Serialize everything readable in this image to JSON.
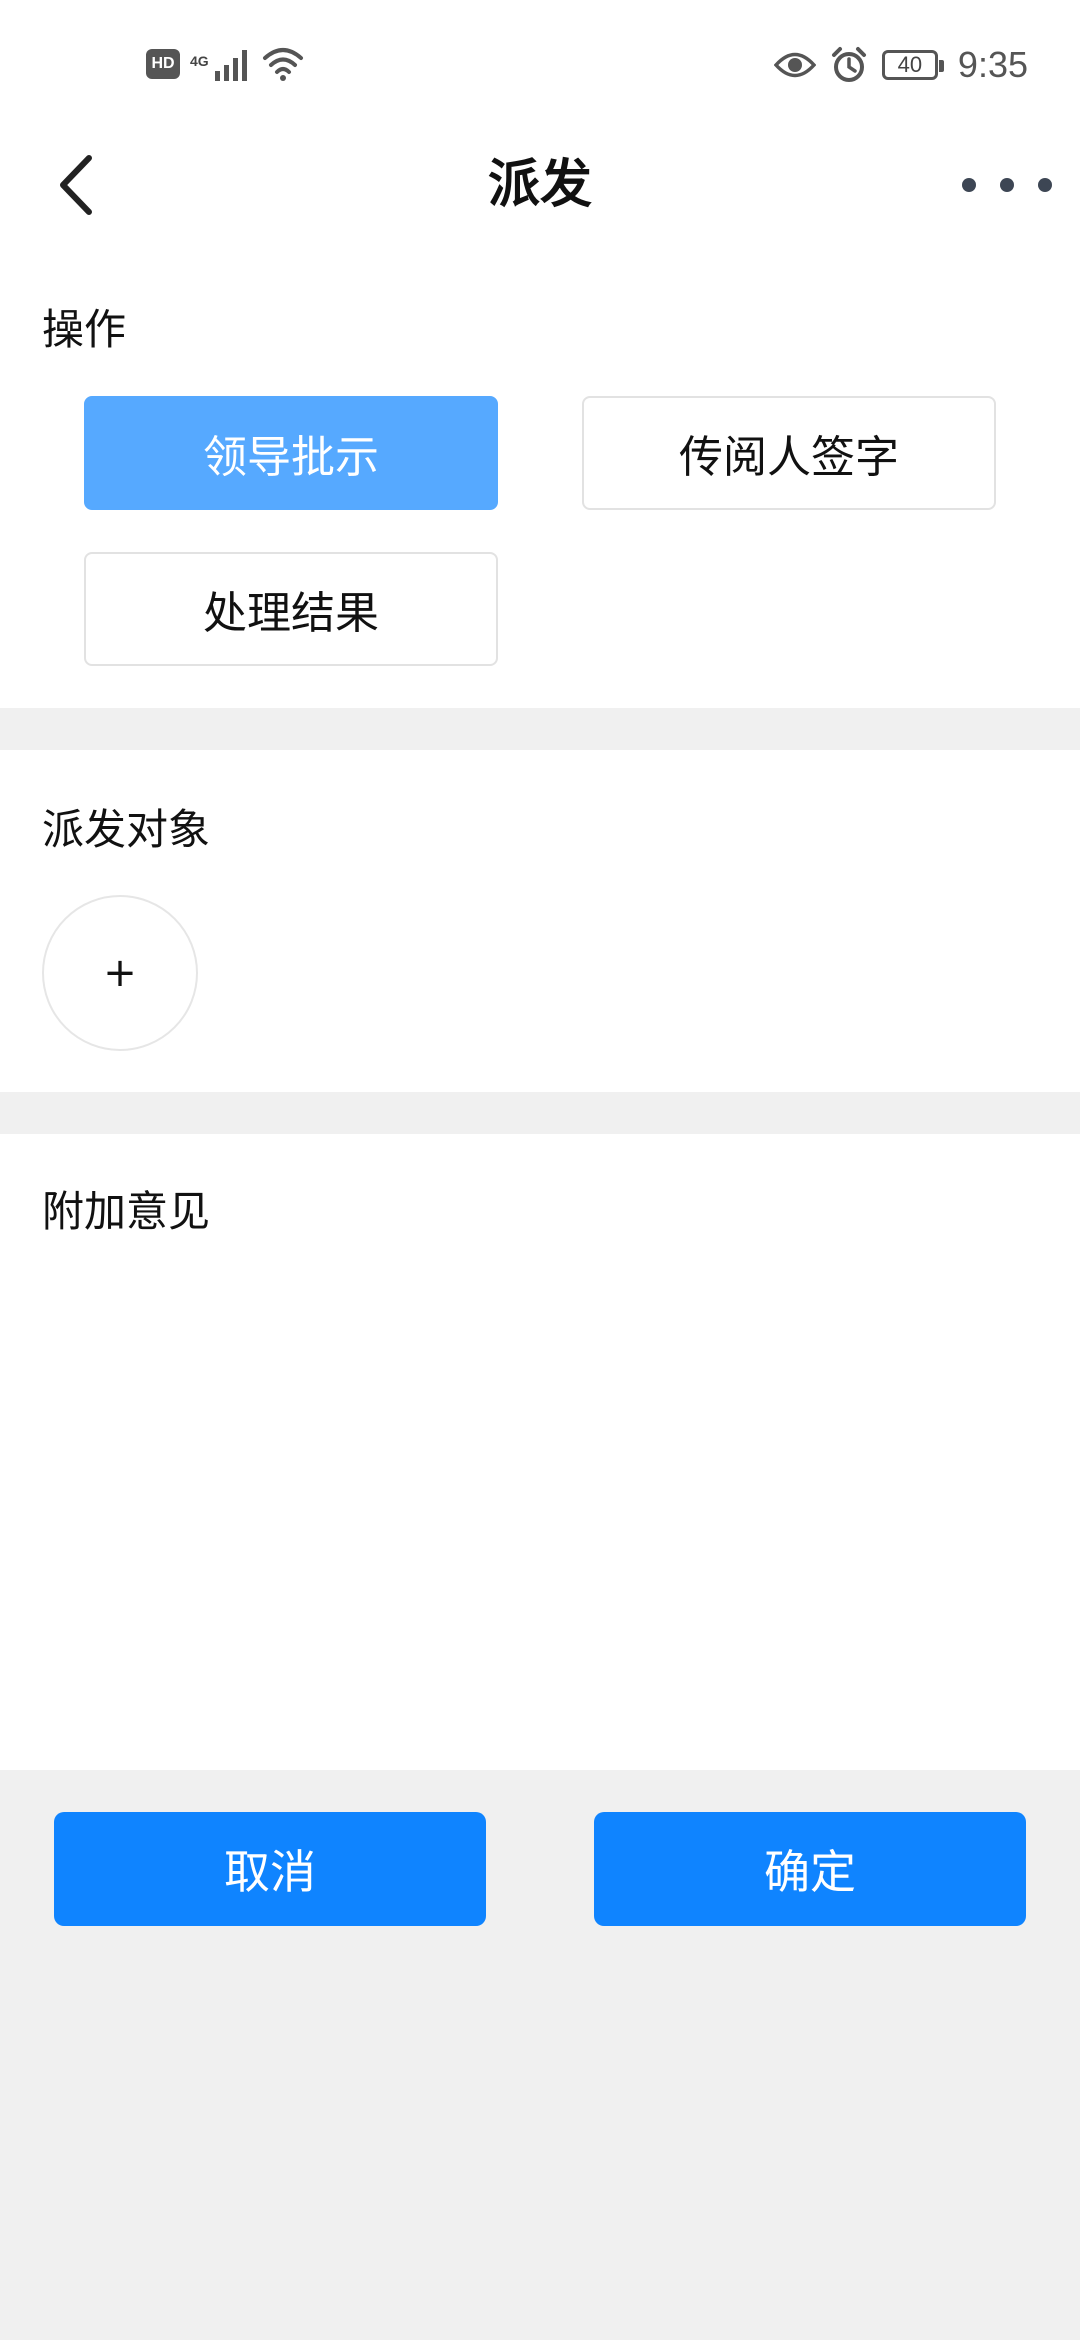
{
  "status_bar": {
    "left_badge": "HD",
    "network": "4G",
    "battery": "40",
    "time": "9:35",
    "icons": [
      "signal-icon",
      "wifi-icon",
      "eye-icon",
      "alarm-icon",
      "battery-icon"
    ]
  },
  "header": {
    "title": "派发",
    "back_icon": "chevron-left-icon",
    "more_icon": "more-horizontal-icon"
  },
  "operation": {
    "title": "操作",
    "options": [
      {
        "label": "领导批示",
        "selected": true
      },
      {
        "label": "传阅人签字",
        "selected": false
      },
      {
        "label": "处理结果",
        "selected": false
      }
    ]
  },
  "recipients": {
    "title": "派发对象",
    "add_label": "+"
  },
  "comments": {
    "title": "附加意见",
    "value": ""
  },
  "footer": {
    "cancel_label": "取消",
    "confirm_label": "确定"
  },
  "colors": {
    "selected_option": "#56a9ff",
    "primary_button": "#0f84ff",
    "page_background": "#f0f0f0"
  }
}
